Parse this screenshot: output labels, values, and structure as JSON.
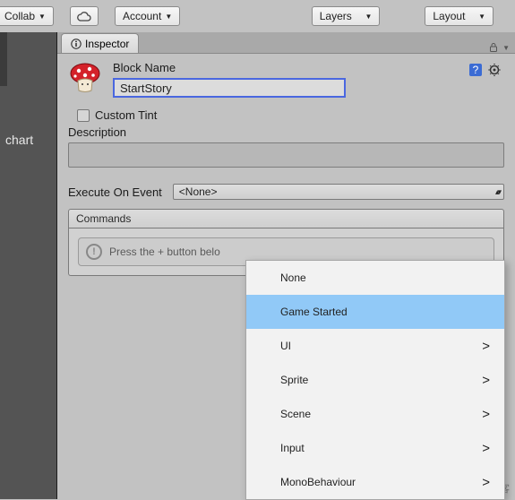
{
  "toolbar": {
    "collab": "Collab",
    "account": "Account",
    "layers": "Layers",
    "layout": "Layout"
  },
  "sidebar": {
    "label": "chart"
  },
  "inspector": {
    "tab_label": "Inspector",
    "block_name_label": "Block Name",
    "block_name_value": "StartStory",
    "custom_tint_label": "Custom Tint",
    "description_label": "Description",
    "execute_label": "Execute On Event",
    "execute_value": "<None>",
    "commands_label": "Commands",
    "commands_hint": "Press the + button belo"
  },
  "dropdown": {
    "items": [
      {
        "label": "None",
        "submenu": false,
        "selected": false
      },
      {
        "label": "Game Started",
        "submenu": false,
        "selected": true
      },
      {
        "label": "UI",
        "submenu": true,
        "selected": false
      },
      {
        "label": "Sprite",
        "submenu": true,
        "selected": false
      },
      {
        "label": "Scene",
        "submenu": true,
        "selected": false
      },
      {
        "label": "Input",
        "submenu": true,
        "selected": false
      },
      {
        "label": "MonoBehaviour",
        "submenu": true,
        "selected": false
      }
    ]
  },
  "watermark": "@51CTO博客"
}
